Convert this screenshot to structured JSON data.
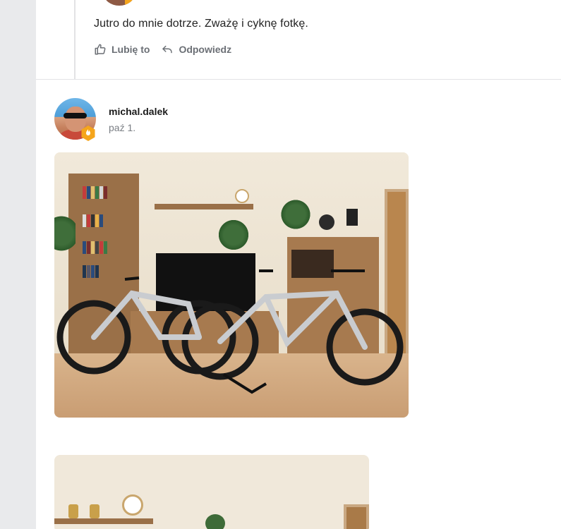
{
  "previous_reply": {
    "text": "Jutro do mnie dotrze. Zważę i cyknę fotkę.",
    "like_label": "Lubię to",
    "reply_label": "Odpowiedz"
  },
  "post": {
    "username": "michal.dalek",
    "date": "paź 1."
  },
  "icons": {
    "like": "thumbs-up-icon",
    "reply": "reply-arrow-icon",
    "badge": "rank-badge-icon"
  },
  "colors": {
    "accent_badge": "#f5a51c",
    "muted_text": "#6b6f75",
    "rail": "#e9eaec"
  }
}
